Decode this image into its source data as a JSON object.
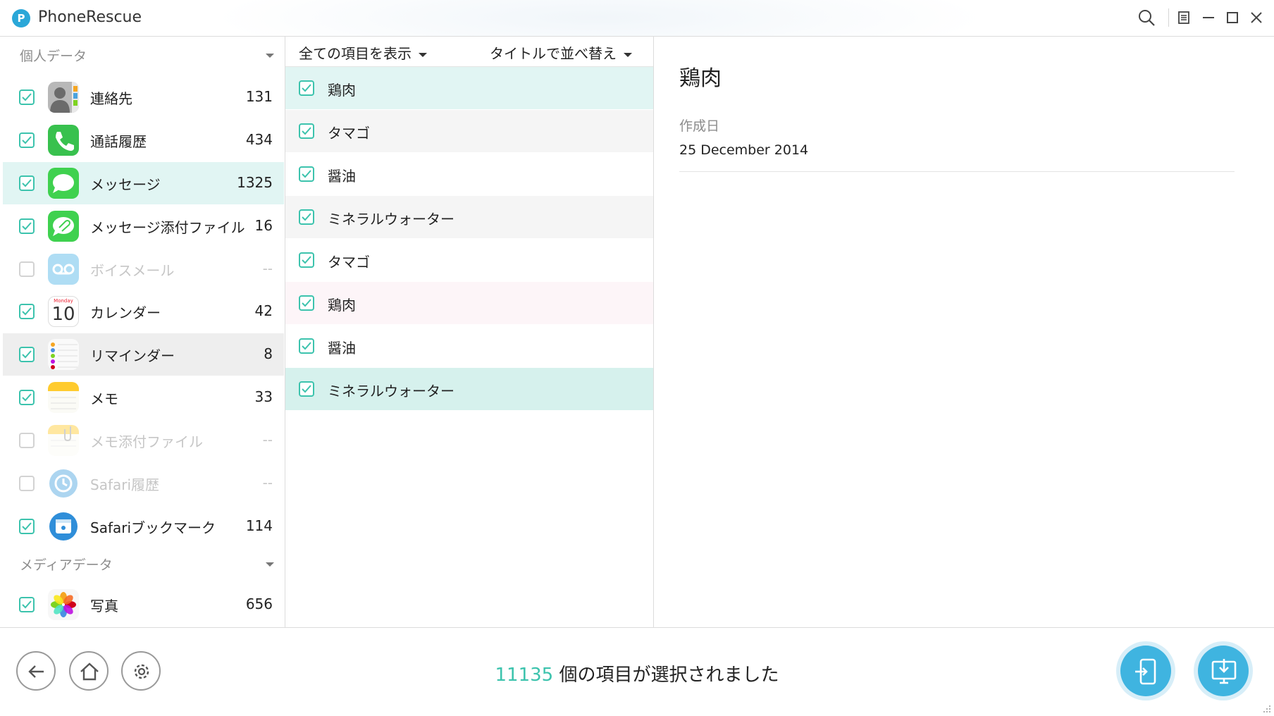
{
  "window": {
    "title": "PhoneRescue",
    "logo_letter": "P"
  },
  "sidebar": {
    "personal_header": "個人データ",
    "media_header": "メディアデータ",
    "items": [
      {
        "label": "連絡先",
        "count": "131",
        "icon": "contacts-icon",
        "checked": true,
        "enabled": true
      },
      {
        "label": "通話履歴",
        "count": "434",
        "icon": "phone-icon",
        "checked": true,
        "enabled": true
      },
      {
        "label": "メッセージ",
        "count": "1325",
        "icon": "messages-icon",
        "checked": true,
        "enabled": true,
        "state": "active"
      },
      {
        "label": "メッセージ添付ファイル",
        "count": "16",
        "icon": "message-attachment-icon",
        "checked": true,
        "enabled": true
      },
      {
        "label": "ボイスメール",
        "count": "--",
        "icon": "voicemail-icon",
        "checked": false,
        "enabled": false
      },
      {
        "label": "カレンダー",
        "count": "42",
        "icon": "calendar-icon",
        "checked": true,
        "enabled": true
      },
      {
        "label": "リマインダー",
        "count": "8",
        "icon": "reminders-icon",
        "checked": true,
        "enabled": true,
        "state": "hover"
      },
      {
        "label": "メモ",
        "count": "33",
        "icon": "notes-icon",
        "checked": true,
        "enabled": true
      },
      {
        "label": "メモ添付ファイル",
        "count": "--",
        "icon": "note-attachment-icon",
        "checked": false,
        "enabled": false
      },
      {
        "label": "Safari履歴",
        "count": "--",
        "icon": "safari-history-icon",
        "checked": false,
        "enabled": false
      },
      {
        "label": "Safariブックマーク",
        "count": "114",
        "icon": "safari-bookmark-icon",
        "checked": true,
        "enabled": true
      },
      {
        "label": "写真",
        "count": "656",
        "icon": "photos-icon",
        "checked": true,
        "enabled": true
      }
    ],
    "calendar_day": "Monday",
    "calendar_date": "10"
  },
  "list": {
    "filter_label": "全ての項目を表示",
    "sort_label": "タイトルで並べ替え",
    "rows": [
      {
        "text": "鶏肉",
        "state": "selected"
      },
      {
        "text": "タマゴ",
        "state": "alt"
      },
      {
        "text": "醤油",
        "state": ""
      },
      {
        "text": "ミネラルウォーター",
        "state": "alt"
      },
      {
        "text": "タマゴ",
        "state": ""
      },
      {
        "text": "鶏肉",
        "state": "pink"
      },
      {
        "text": "醤油",
        "state": ""
      },
      {
        "text": "ミネラルウォーター",
        "state": "selected"
      }
    ]
  },
  "detail": {
    "title": "鶏肉",
    "created_label": "作成日",
    "created_value": "25 December 2014"
  },
  "footer": {
    "selected_count": "11135",
    "selected_suffix": " 個の項目が選択されました"
  },
  "colors": {
    "accent": "#3cc3ad",
    "active_row": "#e1f5f3",
    "button_blue": "#3fb4e0"
  }
}
